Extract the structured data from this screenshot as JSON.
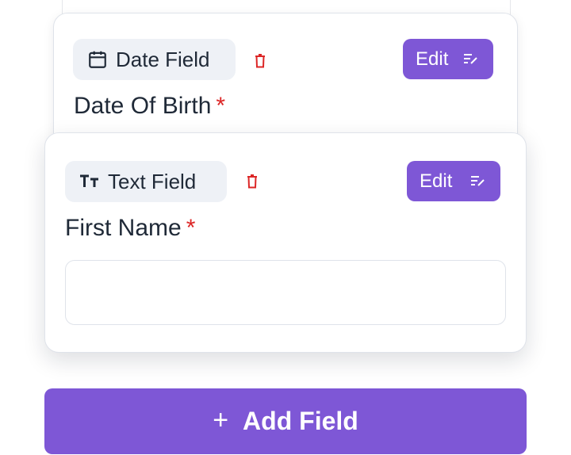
{
  "cards": {
    "date_field": {
      "chip_label": "Date Field",
      "chip_icon": "calendar-icon",
      "edit_label": "Edit",
      "edit_icon": "edit-lines-icon",
      "delete_icon": "trash-icon",
      "title": "Date Of Birth",
      "required_mark": "*"
    },
    "text_field": {
      "chip_label": "Text Field",
      "chip_icon": "text-size-icon",
      "edit_label": "Edit",
      "edit_icon": "edit-lines-icon",
      "delete_icon": "trash-icon",
      "title": "First Name",
      "required_mark": "*",
      "input_value": ""
    }
  },
  "add_field": {
    "label": "Add Field",
    "icon": "plus-icon"
  },
  "colors": {
    "accent": "#7e57d6",
    "danger": "#dc2626",
    "chip_bg": "#eef1f6",
    "text": "#1f2937"
  }
}
